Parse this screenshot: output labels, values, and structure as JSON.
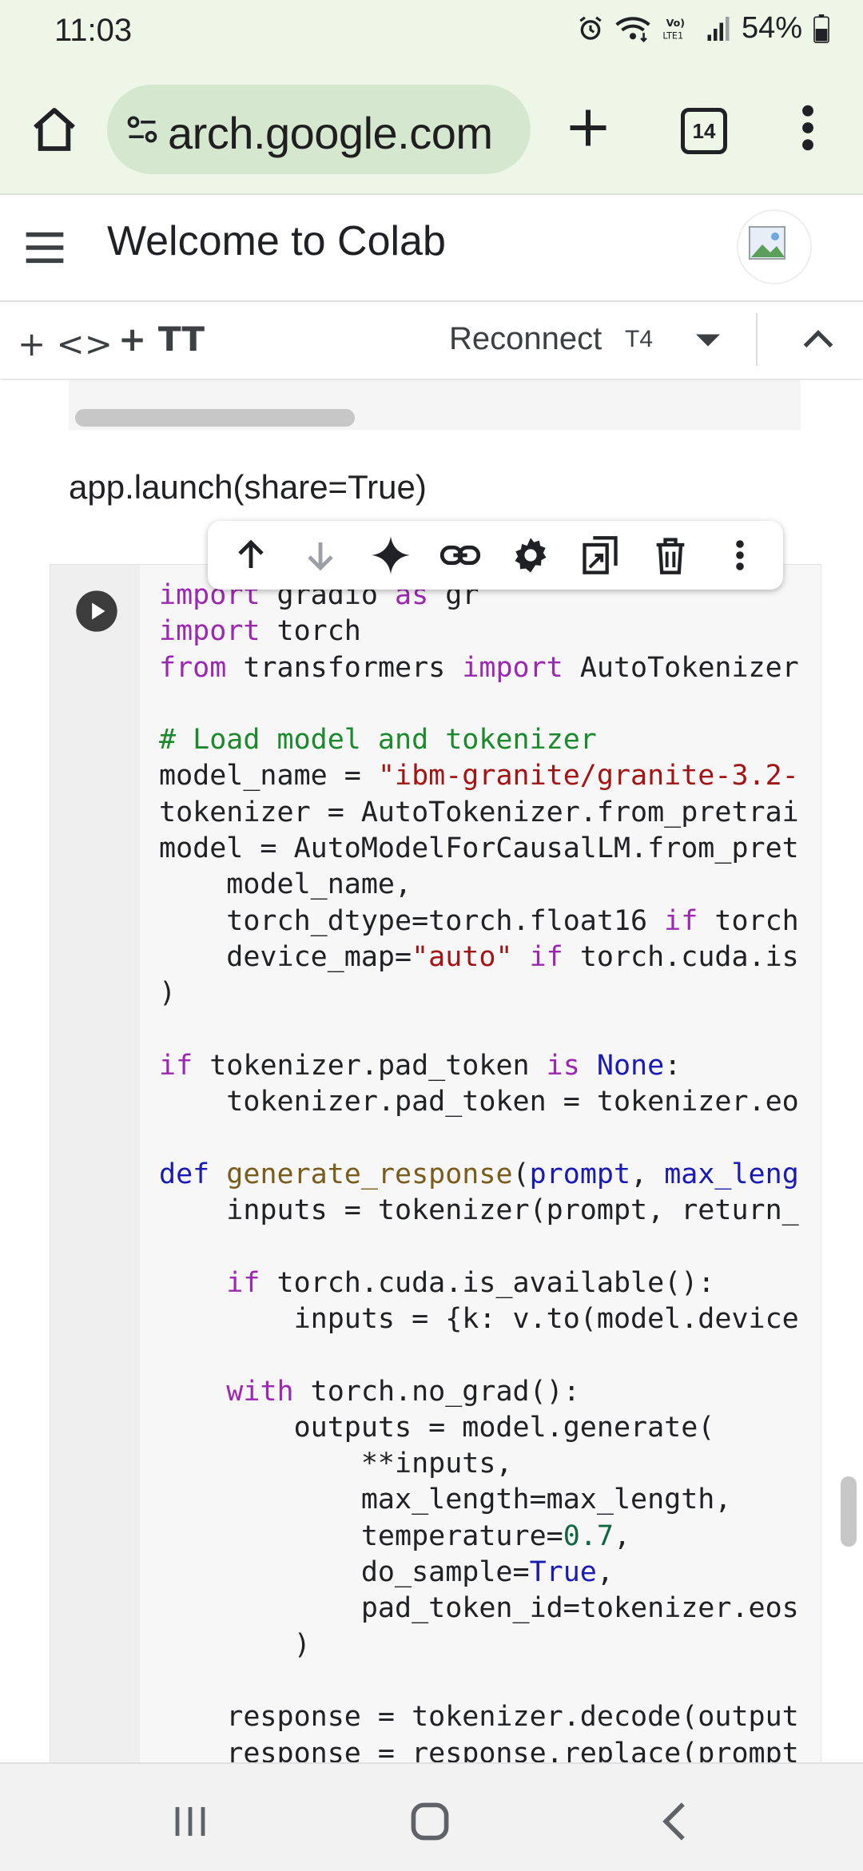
{
  "status_bar": {
    "time": "11:03",
    "battery_percent": "54%",
    "icons": [
      "alarm-icon",
      "wifi-icon",
      "volte-icon",
      "signal-icon",
      "battery-icon"
    ]
  },
  "browser": {
    "url": "arch.google.com",
    "tab_count": "14",
    "icons": [
      "home-icon",
      "site-settings-icon",
      "new-tab-icon",
      "tabs-icon",
      "more-vert-icon"
    ]
  },
  "colab": {
    "title": "Welcome to Colab",
    "toolbar": {
      "add_code_label": "+ <>",
      "add_text_label": "+ TT",
      "reconnect_label": "Reconnect",
      "runtime_type": "T4"
    },
    "text_cell": "app.launch(share=True)",
    "cell_toolbar_icons": [
      "move-up-icon",
      "move-down-icon",
      "gemini-icon",
      "link-icon",
      "settings-icon",
      "mirror-cell-icon",
      "delete-icon",
      "more-vert-icon"
    ],
    "code_lines": [
      "import gradio as gr",
      "import torch",
      "from transformers import AutoTokenizer",
      "",
      "# Load model and tokenizer",
      "model_name = \"ibm-granite/granite-3.2-",
      "tokenizer = AutoTokenizer.from_pretrai",
      "model = AutoModelForCausalLM.from_pret",
      "    model_name,",
      "    torch_dtype=torch.float16 if torch",
      "    device_map=\"auto\" if torch.cuda.is",
      ")",
      "",
      "if tokenizer.pad_token is None:",
      "    tokenizer.pad_token = tokenizer.eo",
      "",
      "def generate_response(prompt, max_leng",
      "    inputs = tokenizer(prompt, return_",
      "",
      "    if torch.cuda.is_available():",
      "        inputs = {k: v.to(model.device",
      "",
      "    with torch.no_grad():",
      "        outputs = model.generate(",
      "            **inputs,",
      "            max_length=max_length,",
      "            temperature=0.7,",
      "            do_sample=True,",
      "            pad_token_id=tokenizer.eos",
      "        )",
      "",
      "    response = tokenizer.decode(output",
      "    response = response.replace(prompt"
    ]
  },
  "colors": {
    "chrome_bg": "#eef6e8",
    "omnibox_bg": "#d5e8cf",
    "keyword": "#9c27b0",
    "def_keyword": "#1a1ab4",
    "comment": "#1b8a2c",
    "string": "#a31515",
    "number": "#116644"
  }
}
